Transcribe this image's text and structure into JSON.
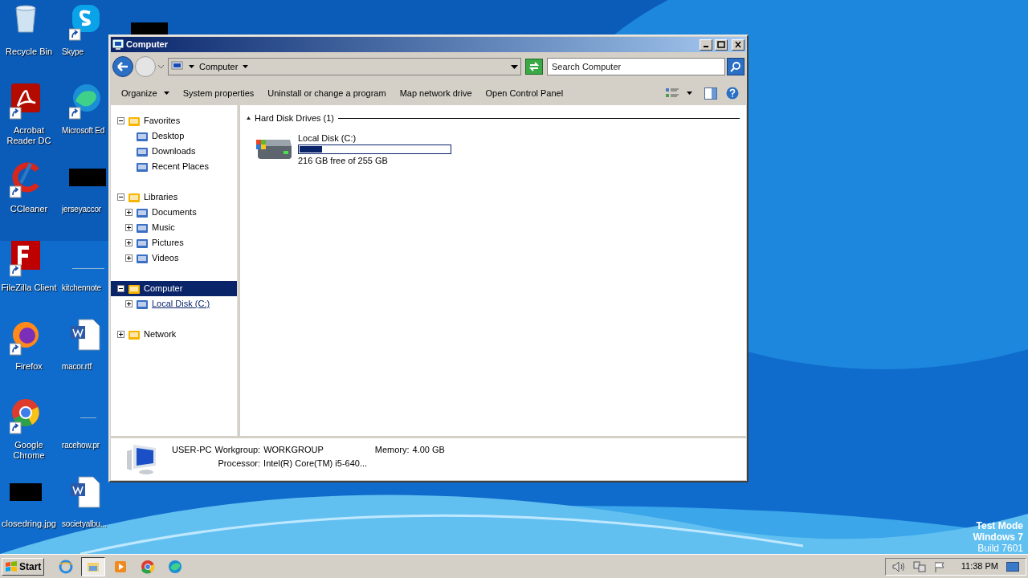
{
  "desktop": {
    "icons": [
      {
        "label": "Recycle Bin",
        "shortcut": false
      },
      {
        "label": "Acrobat Reader DC",
        "shortcut": true
      },
      {
        "label": "CCleaner",
        "shortcut": true
      },
      {
        "label": "FileZilla Client",
        "shortcut": true
      },
      {
        "label": "Firefox",
        "shortcut": true
      },
      {
        "label": "Google Chrome",
        "shortcut": true
      },
      {
        "label": "closedring.jpg",
        "shortcut": false
      },
      {
        "label": "Skype",
        "shortcut": true
      },
      {
        "label": "Microsoft Ed",
        "shortcut": true
      },
      {
        "label": "jerseyaccor",
        "shortcut": false
      },
      {
        "label": "kitchennote",
        "shortcut": false
      },
      {
        "label": "macor.rtf",
        "shortcut": false
      },
      {
        "label": "racehow.pr",
        "shortcut": false
      },
      {
        "label": "societyalbu...",
        "shortcut": false
      }
    ],
    "watermark_lines": [
      "Test Mode",
      "Windows 7",
      "Build 7601"
    ]
  },
  "window": {
    "title": "Computer",
    "address": {
      "breadcrumb": "Computer",
      "search_placeholder": "Search Computer"
    },
    "toolbar": {
      "items": [
        {
          "label": "Organize",
          "menu": true
        },
        {
          "label": "System properties",
          "menu": false
        },
        {
          "label": "Uninstall or change a program",
          "menu": false
        },
        {
          "label": "Map network drive",
          "menu": false
        },
        {
          "label": "Open Control Panel",
          "menu": false
        }
      ]
    },
    "nav_tree": [
      {
        "label": "Favorites",
        "expanded": true,
        "selected": false,
        "children": [
          {
            "label": "Desktop",
            "selected": false
          },
          {
            "label": "Downloads",
            "selected": false
          },
          {
            "label": "Recent Places",
            "selected": false
          }
        ]
      },
      {
        "label": "Libraries",
        "expanded": true,
        "selected": false,
        "children": [
          {
            "label": "Documents",
            "expanded": false,
            "selected": false
          },
          {
            "label": "Music",
            "expanded": false,
            "selected": false
          },
          {
            "label": "Pictures",
            "expanded": false,
            "selected": false
          },
          {
            "label": "Videos",
            "expanded": false,
            "selected": false
          }
        ]
      },
      {
        "label": "Computer",
        "expanded": true,
        "selected": true,
        "children": [
          {
            "label": "Local Disk (C:)",
            "expanded": false,
            "selected": false,
            "hovered": true
          }
        ]
      },
      {
        "label": "Network",
        "expanded": false,
        "selected": false
      }
    ],
    "content": {
      "group": {
        "title": "Hard Disk Drives (1)",
        "expanded": true,
        "drives": [
          {
            "name": "Local Disk (C:)",
            "level": 0.15,
            "space": "216 GB free of 255 GB"
          }
        ]
      }
    },
    "details": {
      "computer_name": "USER-PC",
      "fields": [
        {
          "label": "Workgroup:",
          "value": "WORKGROUP"
        },
        {
          "label": "Memory:",
          "value": "4.00 GB"
        },
        {
          "label": "Processor:",
          "value": "Intel(R) Core(TM) i5-640..."
        }
      ]
    }
  },
  "taskbar": {
    "start": "Start",
    "apps": [
      {
        "selected": false
      },
      {
        "selected": true
      },
      {
        "selected": false
      },
      {
        "selected": false
      },
      {
        "selected": false
      }
    ],
    "clock": "11:38 PM"
  }
}
